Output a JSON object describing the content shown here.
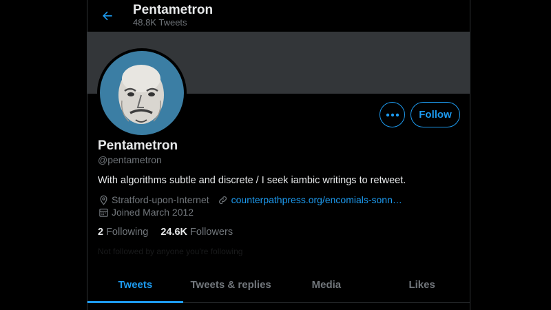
{
  "header": {
    "name": "Pentametron",
    "tweet_count": "48.8K Tweets"
  },
  "profile": {
    "display_name": "Pentametron",
    "handle": "@pentametron",
    "bio": "With algorithms subtle and discrete / I seek iambic writings to retweet.",
    "location": "Stratford-upon-Internet",
    "website": "counterpathpress.org/encomials-sonn…",
    "joined": "Joined March 2012",
    "following_count": "2",
    "following_label": "Following",
    "followers_count": "24.6K",
    "followers_label": "Followers",
    "followed_by_note": "Not followed by anyone you're following"
  },
  "buttons": {
    "follow_label": "Follow"
  },
  "tabs": [
    {
      "label": "Tweets",
      "active": true
    },
    {
      "label": "Tweets & replies",
      "active": false
    },
    {
      "label": "Media",
      "active": false
    },
    {
      "label": "Likes",
      "active": false
    }
  ],
  "colors": {
    "accent": "#1d9bf0",
    "banner": "#333639",
    "avatar_bg": "#3b7ea4",
    "muted_text": "#71767b"
  },
  "icons": {
    "back": "arrow-left-icon",
    "more": "ellipsis-icon",
    "location": "location-pin-icon",
    "link": "link-icon",
    "calendar": "calendar-icon"
  }
}
